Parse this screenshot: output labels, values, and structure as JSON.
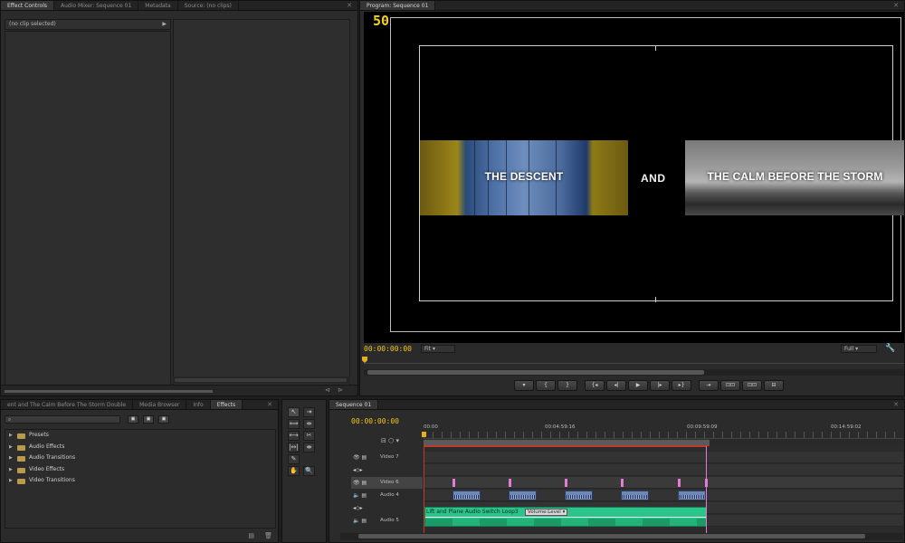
{
  "effect_controls": {
    "tabs": [
      "Effect Controls",
      "Audio Mixer: Sequence 01",
      "Metadata",
      "Source: (no clips)"
    ],
    "clip_header": "(no clip selected)"
  },
  "program_monitor": {
    "tab": "Program: Sequence 01",
    "counter_overlay": "50",
    "left_title": "THE DESCENT",
    "center_title": "AND",
    "right_title": "THE CALM BEFORE THE STORM",
    "timecode": "00:00:00:00",
    "fit": "Fit",
    "quality": "Full",
    "transport": [
      "▾",
      "{",
      "}",
      "{◂",
      "◂|",
      "▶",
      "|▸",
      "▸}",
      "⇥",
      "⊡⊡",
      "⊡⊡",
      "⊟"
    ]
  },
  "effects_panel": {
    "tabs": [
      "ent and The Calm Before The Storm Double",
      "Media Browser",
      "Info",
      "Effects"
    ],
    "search_placeholder": "",
    "items": [
      "Presets",
      "Audio Effects",
      "Audio Transitions",
      "Video Effects",
      "Video Transitions"
    ]
  },
  "tools": [
    "↖",
    "⇥",
    "⟺",
    "⇹",
    "⟷",
    "✂",
    "|↔|",
    "⇼",
    "✎",
    "",
    "✋",
    "🔍"
  ],
  "timeline": {
    "tab": "Sequence 01",
    "timecode": "00:00:00:00",
    "ruler": [
      "00:00",
      "00:04:59:16",
      "00:09:59:09",
      "00:14:59:02"
    ],
    "tracks": [
      {
        "name": "Video 7"
      },
      {
        "name": ""
      },
      {
        "name": "Video 6"
      },
      {
        "name": "Audio 4"
      },
      {
        "name": ""
      },
      {
        "name": "Audio 5"
      }
    ],
    "audio_clip_label": "Lift and Plane Audio Switch Loop3",
    "volume_label": "Volume:Level"
  },
  "colors": {
    "timecode": "#f2c21c",
    "audio_clip": "#2bc48a",
    "marker": "#e27ad8",
    "video_clip": "#6d88b8"
  }
}
